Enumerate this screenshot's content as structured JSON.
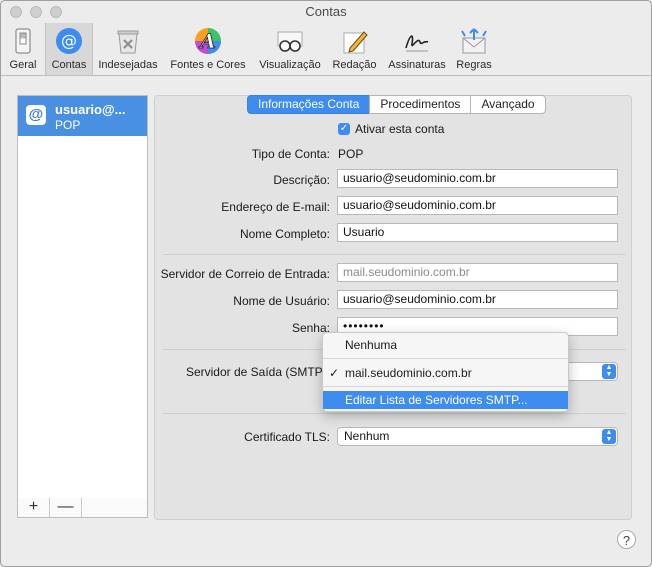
{
  "window": {
    "title": "Contas"
  },
  "toolbar": {
    "items": [
      {
        "label": "Geral",
        "icon": "switch-icon"
      },
      {
        "label": "Contas",
        "icon": "at-icon"
      },
      {
        "label": "Indesejadas",
        "icon": "junk-trash-icon"
      },
      {
        "label": "Fontes e Cores",
        "icon": "fonts-colors-icon"
      },
      {
        "label": "Visualização",
        "icon": "glasses-icon"
      },
      {
        "label": "Redação",
        "icon": "pencil-icon"
      },
      {
        "label": "Assinaturas",
        "icon": "signature-icon"
      },
      {
        "label": "Regras",
        "icon": "rules-envelope-icon"
      }
    ]
  },
  "sidebar": {
    "account": {
      "name": "usuario@...",
      "type": "POP",
      "icon": "@"
    },
    "add_label": "+",
    "remove_label": "—"
  },
  "tabs": [
    "Informações Conta",
    "Procedimentos",
    "Avançado"
  ],
  "form": {
    "enable_label": "Ativar esta conta",
    "account_type_label": "Tipo de Conta:",
    "account_type_value": "POP",
    "description_label": "Descrição:",
    "description_value": "usuario@seudominio.com.br",
    "email_label": "Endereço de E-mail:",
    "email_value": "usuario@seudominio.com.br",
    "fullname_label": "Nome Completo:",
    "fullname_value": "Usuario",
    "incoming_label": "Servidor de Correio de Entrada:",
    "incoming_placeholder": "mail.seudominio.com.br",
    "username_label": "Nome de Usuário:",
    "username_value": "usuario@seudominio.com.br",
    "password_label": "Senha:",
    "password_value": "••••••••",
    "outgoing_label": "Servidor de Saída (SMTP):",
    "tls_label": "Certificado TLS:",
    "tls_value": "Nenhum"
  },
  "smtp_menu": {
    "items": [
      "Nenhuma",
      "mail.seudominio.com.br",
      "Editar Lista de Servidores SMTP..."
    ],
    "checked_mark": "✓"
  },
  "help_label": "?",
  "accent_color": "#3e8cf0"
}
